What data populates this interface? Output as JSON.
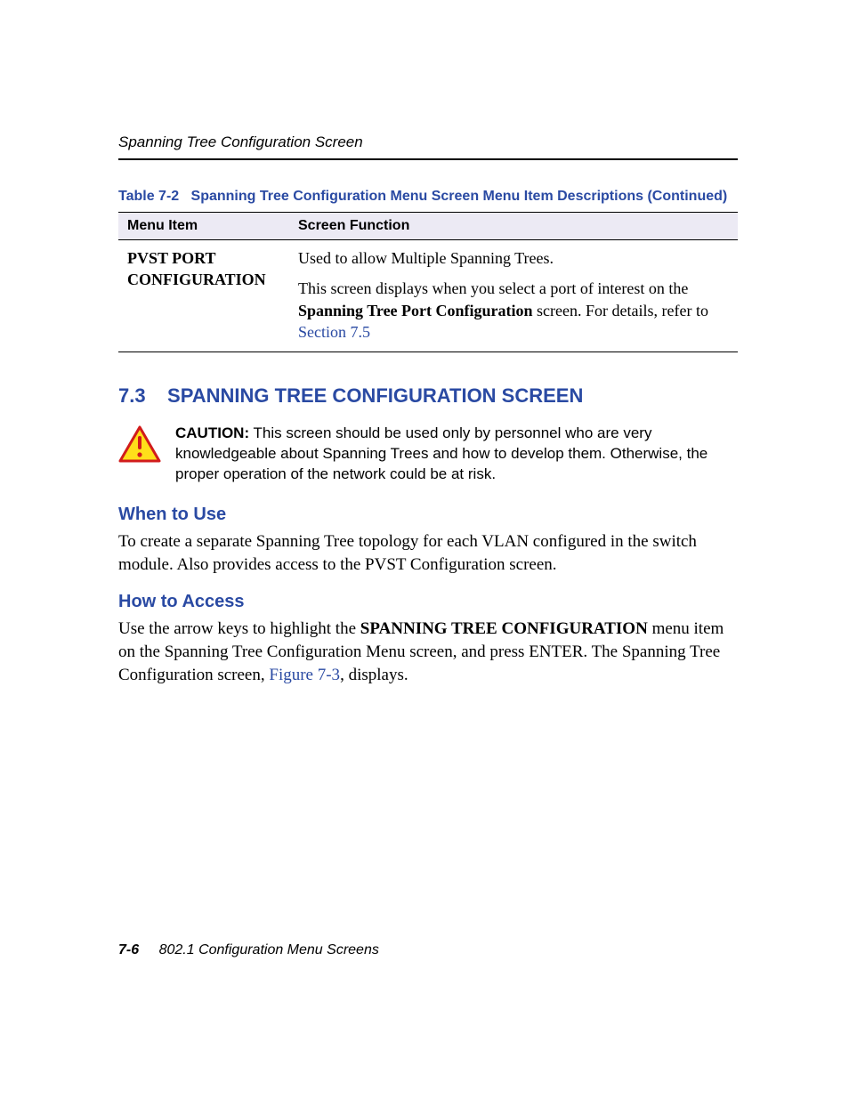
{
  "header": {
    "running_title": "Spanning Tree Configuration Screen"
  },
  "table": {
    "caption_prefix": "Table 7-2",
    "caption_rest": "Spanning Tree Configuration Menu Screen Menu Item Descriptions (Continued)",
    "col1": "Menu Item",
    "col2": "Screen Function",
    "row": {
      "menu_item_line1": "PVST PORT",
      "menu_item_line2": "CONFIGURATION",
      "func_p1": "Used to allow Multiple Spanning Trees.",
      "func_p2_a": "This screen displays when you select a port of interest on the ",
      "func_p2_b_bold": "Spanning Tree Port Configuration",
      "func_p2_c": " screen. For details, refer to ",
      "func_p2_link": "Section 7.5"
    }
  },
  "section": {
    "number": "7.3",
    "title": "SPANNING TREE CONFIGURATION SCREEN"
  },
  "caution": {
    "label": "CAUTION:",
    "text": "This screen should be used only by personnel who are very knowledgeable about Spanning Trees and how to develop them. Otherwise, the proper operation of the network could be at risk."
  },
  "when": {
    "heading": "When to Use",
    "body": "To create a separate Spanning Tree topology for each VLAN configured in the switch module. Also provides access to the PVST Configuration screen."
  },
  "how": {
    "heading": "How to Access",
    "body_a": "Use the arrow keys to highlight the ",
    "body_bold": "SPANNING TREE CONFIGURATION",
    "body_b": " menu item on the Spanning Tree Configuration Menu screen, and press ENTER. The Spanning Tree Configuration screen, ",
    "body_link": "Figure 7-3",
    "body_c": ", displays."
  },
  "footer": {
    "page": "7-6",
    "title": "802.1 Configuration Menu Screens"
  }
}
